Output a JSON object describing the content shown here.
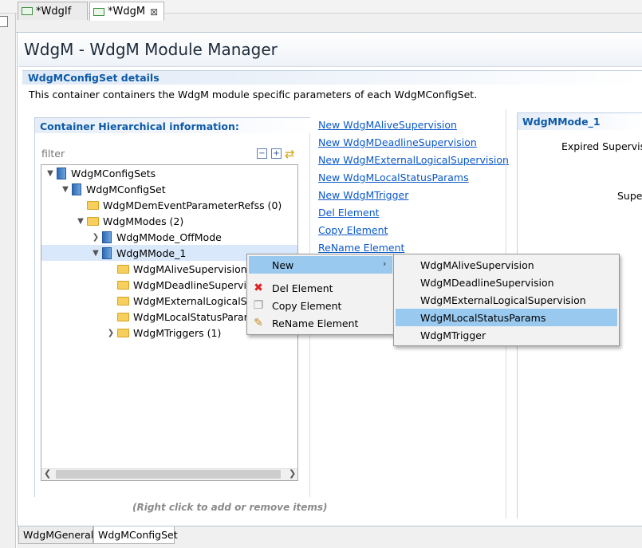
{
  "tabs": [
    {
      "label": "*WdgIf"
    },
    {
      "label": "*WdgM",
      "close": "⊠"
    }
  ],
  "editor": {
    "title": "WdgM - WdgM Module Manager",
    "section_title": "WdgMConfigSet details",
    "section_desc": "This container containers the WdgM module specific parameters of each WdgMConfigSet."
  },
  "hierarchy": {
    "title": "Container Hierarchical information:",
    "filter_placeholder": "filter",
    "hint": "(Right click to add or remove items)",
    "tree": [
      {
        "label": "WdgMConfigSets",
        "icon": "doc-icon",
        "expander": "down"
      },
      {
        "label": "WdgMConfigSet",
        "icon": "doc-icon",
        "expander": "down"
      },
      {
        "label": "WdgMDemEventParameterRefss (0)",
        "icon": "folder-icon",
        "expander": "none"
      },
      {
        "label": "WdgMModes (2)",
        "icon": "folder-icon",
        "expander": "down"
      },
      {
        "label": "WdgMMode_OffMode",
        "icon": "doc-icon",
        "expander": "right"
      },
      {
        "label": "WdgMMode_1",
        "icon": "doc-icon",
        "expander": "down",
        "selected": true
      },
      {
        "label": "WdgMAliveSupervisions",
        "icon": "folder-icon",
        "expander": "none"
      },
      {
        "label": "WdgMDeadlineSupervis",
        "icon": "folder-icon",
        "expander": "none"
      },
      {
        "label": "WdgMExternalLogicalSu",
        "icon": "folder-icon",
        "expander": "none"
      },
      {
        "label": "WdgMLocalStatusParam",
        "icon": "folder-icon",
        "expander": "none"
      },
      {
        "label": "WdgMTriggers (1)",
        "icon": "folder-icon",
        "expander": "right"
      }
    ]
  },
  "links": [
    "New WdgMAliveSupervision",
    "New WdgMDeadlineSupervision",
    "New WdgMExternalLogicalSupervision",
    "New WdgMLocalStatusParams",
    "New WdgMTrigger",
    "Del Element",
    "Copy Element",
    "ReName Element"
  ],
  "right_panel": {
    "title": "WdgMMode_1",
    "label1": "Expired Supervisi",
    "label2": "Super"
  },
  "context_menu": {
    "items": [
      {
        "label": "New",
        "icon": "",
        "highlighted": true,
        "submenu_arrow": "›"
      },
      {
        "label": "Del Element",
        "icon": "delete-icon"
      },
      {
        "label": "Copy Element",
        "icon": "copy-icon"
      },
      {
        "label": "ReName Element",
        "icon": "pencil-icon"
      }
    ]
  },
  "submenu": {
    "items": [
      {
        "label": "WdgMAliveSupervision"
      },
      {
        "label": "WdgMDeadlineSupervision"
      },
      {
        "label": "WdgMExternalLogicalSupervision"
      },
      {
        "label": "WdgMLocalStatusParams",
        "highlighted": true
      },
      {
        "label": "WdgMTrigger"
      }
    ]
  },
  "bottom_tabs": [
    {
      "label": "WdgMGeneral"
    },
    {
      "label": "WdgMConfigSet",
      "active": true
    }
  ],
  "colors": {
    "link": "#0a58c9",
    "section_title": "#0d5aa8",
    "selection": "#d9e8fb",
    "menu_highlight": "#99c9ef"
  }
}
